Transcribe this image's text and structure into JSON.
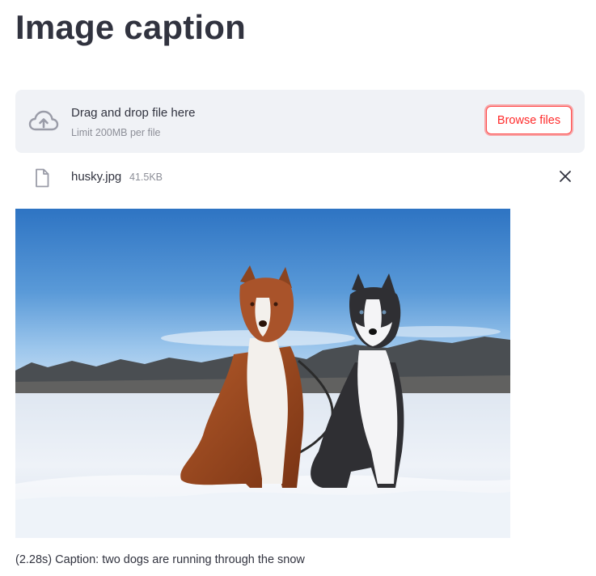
{
  "page": {
    "title": "Image caption"
  },
  "uploader": {
    "drop_title": "Drag and drop file here",
    "limit_text": "Limit 200MB per file",
    "browse_label": "Browse files",
    "icon": "cloud-upload-icon"
  },
  "file": {
    "name": "husky.jpg",
    "size": "41.5KB",
    "icon": "file-icon",
    "remove_icon": "close-icon"
  },
  "result": {
    "caption": "(2.28s) Caption: two dogs are running through the snow"
  },
  "colors": {
    "accent": "#ff4b4b",
    "dropzone_bg": "#f0f2f6",
    "text": "#31333f",
    "muted": "#8d8f98"
  }
}
